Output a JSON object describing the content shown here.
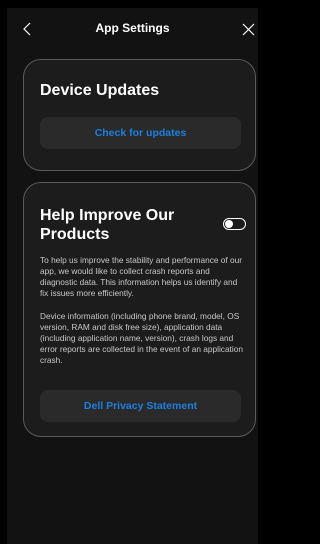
{
  "header": {
    "title": "App Settings",
    "back_icon": "chevron-left-icon",
    "close_icon": "close-icon"
  },
  "updates_card": {
    "title": "Device Updates",
    "button_label": "Check for updates"
  },
  "help_card": {
    "title": "Help Improve Our Products",
    "toggle_state": false,
    "paragraph_1": "To help us improve the stability and performance of our app, we would like to collect crash reports and diagnostic data. This information helps us identify and fix issues more efficiently.",
    "paragraph_2": "Device information (including phone brand, model, OS version, RAM and disk free size), application data (including application name, version), crash logs and error reports are collected in the event of an application crash.",
    "button_label": "Dell Privacy Statement"
  },
  "colors": {
    "background": "#121212",
    "card": "#1c1c1c",
    "card_border": "#5a5a5a",
    "button": "#2a2a2a",
    "accent": "#1d7fe0"
  }
}
